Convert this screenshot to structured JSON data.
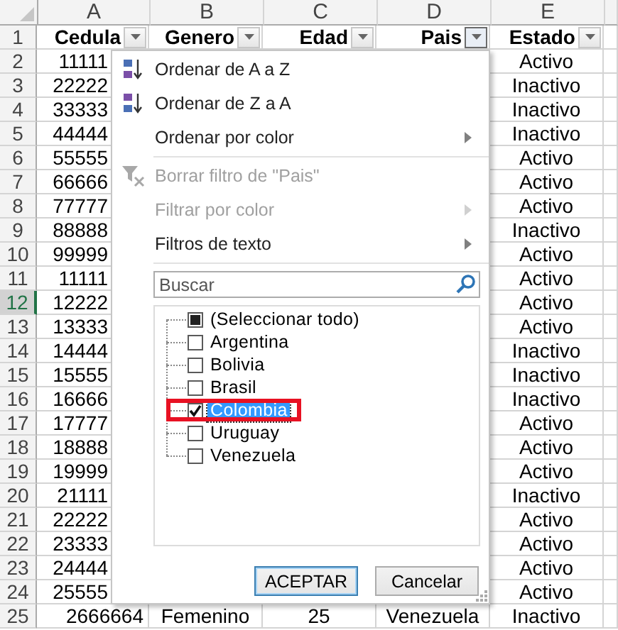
{
  "column_letters": [
    "A",
    "B",
    "C",
    "D",
    "E"
  ],
  "header_row": {
    "number": "1",
    "selected": false,
    "headers": [
      {
        "label": "Cedula",
        "filter_active": false
      },
      {
        "label": "Genero",
        "filter_active": false
      },
      {
        "label": "Edad",
        "filter_active": false
      },
      {
        "label": "Pais",
        "filter_active": true
      },
      {
        "label": "Estado",
        "filter_active": false
      }
    ]
  },
  "rows": [
    {
      "number": "2",
      "selected": false,
      "cedula": "11111",
      "estado": "Activo"
    },
    {
      "number": "3",
      "selected": false,
      "cedula": "22222",
      "estado": "Inactivo"
    },
    {
      "number": "4",
      "selected": false,
      "cedula": "33333",
      "estado": "Inactivo"
    },
    {
      "number": "5",
      "selected": false,
      "cedula": "44444",
      "estado": "Inactivo"
    },
    {
      "number": "6",
      "selected": false,
      "cedula": "55555",
      "estado": "Activo"
    },
    {
      "number": "7",
      "selected": false,
      "cedula": "66666",
      "estado": "Activo"
    },
    {
      "number": "8",
      "selected": false,
      "cedula": "77777",
      "estado": "Activo"
    },
    {
      "number": "9",
      "selected": false,
      "cedula": "88888",
      "estado": "Inactivo"
    },
    {
      "number": "10",
      "selected": false,
      "cedula": "99999",
      "estado": "Activo"
    },
    {
      "number": "11",
      "selected": false,
      "cedula": "11111",
      "estado": "Activo"
    },
    {
      "number": "12",
      "selected": true,
      "cedula": "12222",
      "estado": "Activo"
    },
    {
      "number": "13",
      "selected": false,
      "cedula": "13333",
      "estado": "Activo"
    },
    {
      "number": "14",
      "selected": false,
      "cedula": "14444",
      "estado": "Inactivo"
    },
    {
      "number": "15",
      "selected": false,
      "cedula": "15555",
      "estado": "Inactivo"
    },
    {
      "number": "16",
      "selected": false,
      "cedula": "16666",
      "estado": "Inactivo"
    },
    {
      "number": "17",
      "selected": false,
      "cedula": "17777",
      "estado": "Activo"
    },
    {
      "number": "18",
      "selected": false,
      "cedula": "18888",
      "estado": "Activo"
    },
    {
      "number": "19",
      "selected": false,
      "cedula": "19999",
      "estado": "Activo"
    },
    {
      "number": "20",
      "selected": false,
      "cedula": "21111",
      "estado": "Inactivo"
    },
    {
      "number": "21",
      "selected": false,
      "cedula": "22222",
      "estado": "Activo"
    },
    {
      "number": "22",
      "selected": false,
      "cedula": "23333",
      "estado": "Activo"
    },
    {
      "number": "23",
      "selected": false,
      "cedula": "24444",
      "estado": "Activo"
    },
    {
      "number": "24",
      "selected": false,
      "cedula": "25555",
      "estado": "Activo"
    },
    {
      "number": "25",
      "selected": false,
      "cedula": "2666664",
      "genero": "Femenino",
      "edad": "25",
      "pais": "Venezuela",
      "estado": "Inactivo"
    }
  ],
  "filter_menu": {
    "menu_groups": [
      [
        {
          "kind": "sort_asc",
          "label": "Ordenar de A a Z",
          "disabled": false,
          "submenu": false
        },
        {
          "kind": "sort_desc",
          "label": "Ordenar de Z a A",
          "disabled": false,
          "submenu": false
        },
        {
          "kind": "plain",
          "label": "Ordenar por color",
          "disabled": false,
          "submenu": true
        }
      ],
      [
        {
          "kind": "clear_filter",
          "label": "Borrar filtro de \"Pais\"",
          "disabled": true,
          "submenu": false
        },
        {
          "kind": "plain",
          "label": "Filtrar por color",
          "disabled": true,
          "submenu": true
        },
        {
          "kind": "plain",
          "label": "Filtros de texto",
          "disabled": false,
          "submenu": true
        }
      ]
    ],
    "search": {
      "placeholder": "Buscar"
    },
    "values": [
      {
        "label": "(Seleccionar todo)",
        "checked": false,
        "indeterminate": true,
        "selected": false,
        "marked": false
      },
      {
        "label": "Argentina",
        "checked": false,
        "indeterminate": false,
        "selected": false,
        "marked": false
      },
      {
        "label": "Bolivia",
        "checked": false,
        "indeterminate": false,
        "selected": false,
        "marked": false
      },
      {
        "label": "Brasil",
        "checked": false,
        "indeterminate": false,
        "selected": false,
        "marked": false
      },
      {
        "label": "Colombia",
        "checked": true,
        "indeterminate": false,
        "selected": true,
        "marked": true
      },
      {
        "label": "Uruguay",
        "checked": false,
        "indeterminate": false,
        "selected": false,
        "marked": false
      },
      {
        "label": "Venezuela",
        "checked": false,
        "indeterminate": false,
        "selected": false,
        "marked": false
      }
    ],
    "buttons": [
      {
        "label": "ACEPTAR",
        "default": true
      },
      {
        "label": "Cancelar",
        "default": false
      }
    ]
  }
}
